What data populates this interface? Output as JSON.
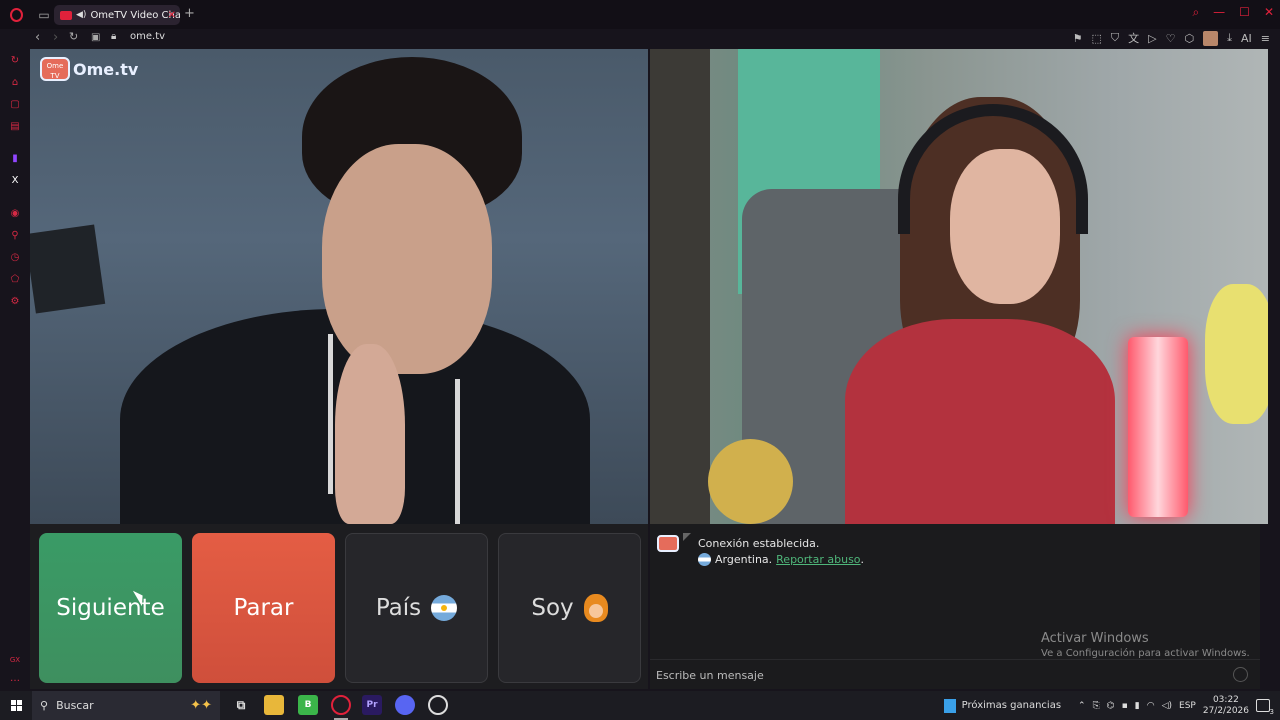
{
  "browser": {
    "tab_title": "OmeTV Video Chat — ",
    "url": "ome.tv"
  },
  "brand": {
    "logo_text": "Ome.tv",
    "logo_badge": "Ome TV",
    "accent": "#e0213b"
  },
  "controls": {
    "next_label": "Siguiente",
    "stop_label": "Parar",
    "country_label": "País",
    "country_flag": "argentina-flag-icon",
    "me_label": "Soy",
    "me_icon": "user-avatar-icon"
  },
  "chat": {
    "status": "Conexión establecida.",
    "country": "Argentina.",
    "report_link": "Reportar abuso",
    "report_suffix": ".",
    "input_placeholder": "Escribe un mensaje",
    "watermark_title": "Activar Windows",
    "watermark_sub": "Ve a Configuración para activar Windows."
  },
  "taskbar": {
    "search_label": "Buscar",
    "news_label": "Próximas ganancias",
    "language": "ESP",
    "time": "03:22",
    "date": "27/2/2026",
    "notifications": "3"
  },
  "colors": {
    "next_button": "#3a9b66",
    "stop_button": "#e45d44",
    "report_link": "#4fb67a"
  }
}
